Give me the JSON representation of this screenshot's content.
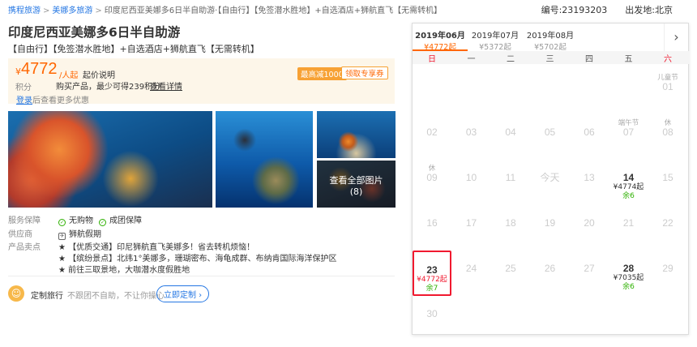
{
  "breadcrumb": [
    "携程旅游",
    "美娜多旅游",
    "印度尼西亚美娜多6日半自助游·【自由行】【免签潜水胜地】+自选酒店+狮航直飞【无需转机】"
  ],
  "product_no": "编号:23193203",
  "departure": "出发地:北京",
  "title": "印度尼西亚美娜多6日半自助游",
  "tags": "【自由行】【免签潜水胜地】+自选酒店+狮航直飞【无需转机】",
  "price": {
    "currency": "¥",
    "amount": "4772",
    "unit": "/人起",
    "explain": "起价说明",
    "points_label": "积分",
    "points_desc": "购买产品，最少可得239积分",
    "points_link": "查看详情",
    "coupon_badge": "最高减1000",
    "coupon_button": "领取专享券"
  },
  "login_hint": {
    "link": "登录",
    "text": "后查看更多优惠"
  },
  "photo_more": {
    "label": "查看全部图片",
    "count": "(8)"
  },
  "service": {
    "label": "服务保障",
    "items": [
      "无购物",
      "成团保障"
    ],
    "supplier_label": "供应商",
    "supplier": "狮航假期",
    "feature_label": "产品卖点",
    "features": [
      "★ 【优质交通】印尼狮航直飞美娜多！省去转机烦恼！",
      "★ 【缤纷景点】北纬1°美娜多，珊瑚密布、海龟成群、布纳肯国际海洋保护区",
      "★ 前往三取景地，大咖潜水度假胜地"
    ]
  },
  "custom": {
    "avatar": "☺",
    "title": "定制旅行",
    "desc": "不跟团不自助，不让你操心",
    "button": "立即定制 ›"
  },
  "calendar": {
    "months": [
      {
        "name": "2019年06月",
        "price": "¥4772起"
      },
      {
        "name": "2019年07月",
        "price": "¥5372起"
      },
      {
        "name": "2019年08月",
        "price": "¥5702起"
      }
    ],
    "next_icon": "chevron-right-icon",
    "next_glyph": "›",
    "weekdays": [
      "日",
      "一",
      "二",
      "三",
      "四",
      "五",
      "六"
    ],
    "cells": [
      {
        "day": "01",
        "note": "儿童节",
        "col": 6,
        "row": 0
      },
      {
        "day": "02",
        "col": 0,
        "row": 1
      },
      {
        "day": "03",
        "col": 1,
        "row": 1
      },
      {
        "day": "04",
        "col": 2,
        "row": 1
      },
      {
        "day": "05",
        "col": 3,
        "row": 1
      },
      {
        "day": "06",
        "col": 4,
        "row": 1
      },
      {
        "day": "07",
        "note": "端午节",
        "col": 5,
        "row": 1
      },
      {
        "day": "08",
        "note": "休",
        "col": 6,
        "row": 1
      },
      {
        "day": "09",
        "note": "休",
        "col": 0,
        "row": 2
      },
      {
        "day": "10",
        "col": 1,
        "row": 2
      },
      {
        "day": "11",
        "col": 2,
        "row": 2
      },
      {
        "day": "今天",
        "col": 3,
        "row": 2
      },
      {
        "day": "13",
        "col": 4,
        "row": 2
      },
      {
        "day": "14",
        "price": "¥4774起",
        "stock": "余6",
        "avail": true,
        "col": 5,
        "row": 2
      },
      {
        "day": "15",
        "col": 6,
        "row": 2
      },
      {
        "day": "16",
        "col": 0,
        "row": 3
      },
      {
        "day": "17",
        "col": 1,
        "row": 3
      },
      {
        "day": "18",
        "col": 2,
        "row": 3
      },
      {
        "day": "19",
        "col": 3,
        "row": 3
      },
      {
        "day": "20",
        "col": 4,
        "row": 3
      },
      {
        "day": "21",
        "col": 5,
        "row": 3
      },
      {
        "day": "22",
        "col": 6,
        "row": 3
      },
      {
        "day": "23",
        "price": "¥4772起",
        "stock": "余7",
        "avail": true,
        "selected": true,
        "col": 0,
        "row": 4
      },
      {
        "day": "24",
        "col": 1,
        "row": 4
      },
      {
        "day": "25",
        "col": 2,
        "row": 4
      },
      {
        "day": "26",
        "col": 3,
        "row": 4
      },
      {
        "day": "27",
        "col": 4,
        "row": 4
      },
      {
        "day": "28",
        "price": "¥7035起",
        "stock": "余6",
        "avail": true,
        "col": 5,
        "row": 4
      },
      {
        "day": "29",
        "col": 6,
        "row": 4
      },
      {
        "day": "30",
        "col": 0,
        "row": 5
      }
    ]
  },
  "colors": {
    "accent": "#ff6600",
    "link": "#2577e3",
    "red": "#f0192f",
    "green": "#2db000"
  }
}
